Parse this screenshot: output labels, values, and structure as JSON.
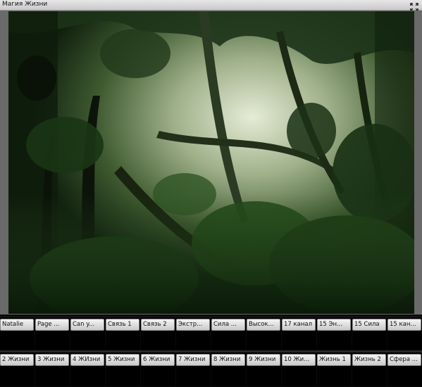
{
  "window": {
    "title": "Магия Жизни"
  },
  "icons": {
    "fullscreen": "fullscreen-icon"
  },
  "buttons_row1": [
    "Natalie",
    "Page ...",
    "Can y...",
    "Связь 1",
    "Связь 2",
    "Экстр...",
    "Сила ...",
    "Высок...",
    "17 канал",
    "15 Эн...",
    "15 Сила",
    "15 кан..."
  ],
  "buttons_row2": [
    "2 Жизни",
    "3 Жизни",
    "4 ЖИзни",
    "5 Жизни",
    "6 Жизни",
    "7 Жизни",
    "8 Жизни",
    "9 Жизни",
    "10 Жи...",
    "Жизнь 1",
    "Жизнь 2",
    "Сфера ..."
  ]
}
